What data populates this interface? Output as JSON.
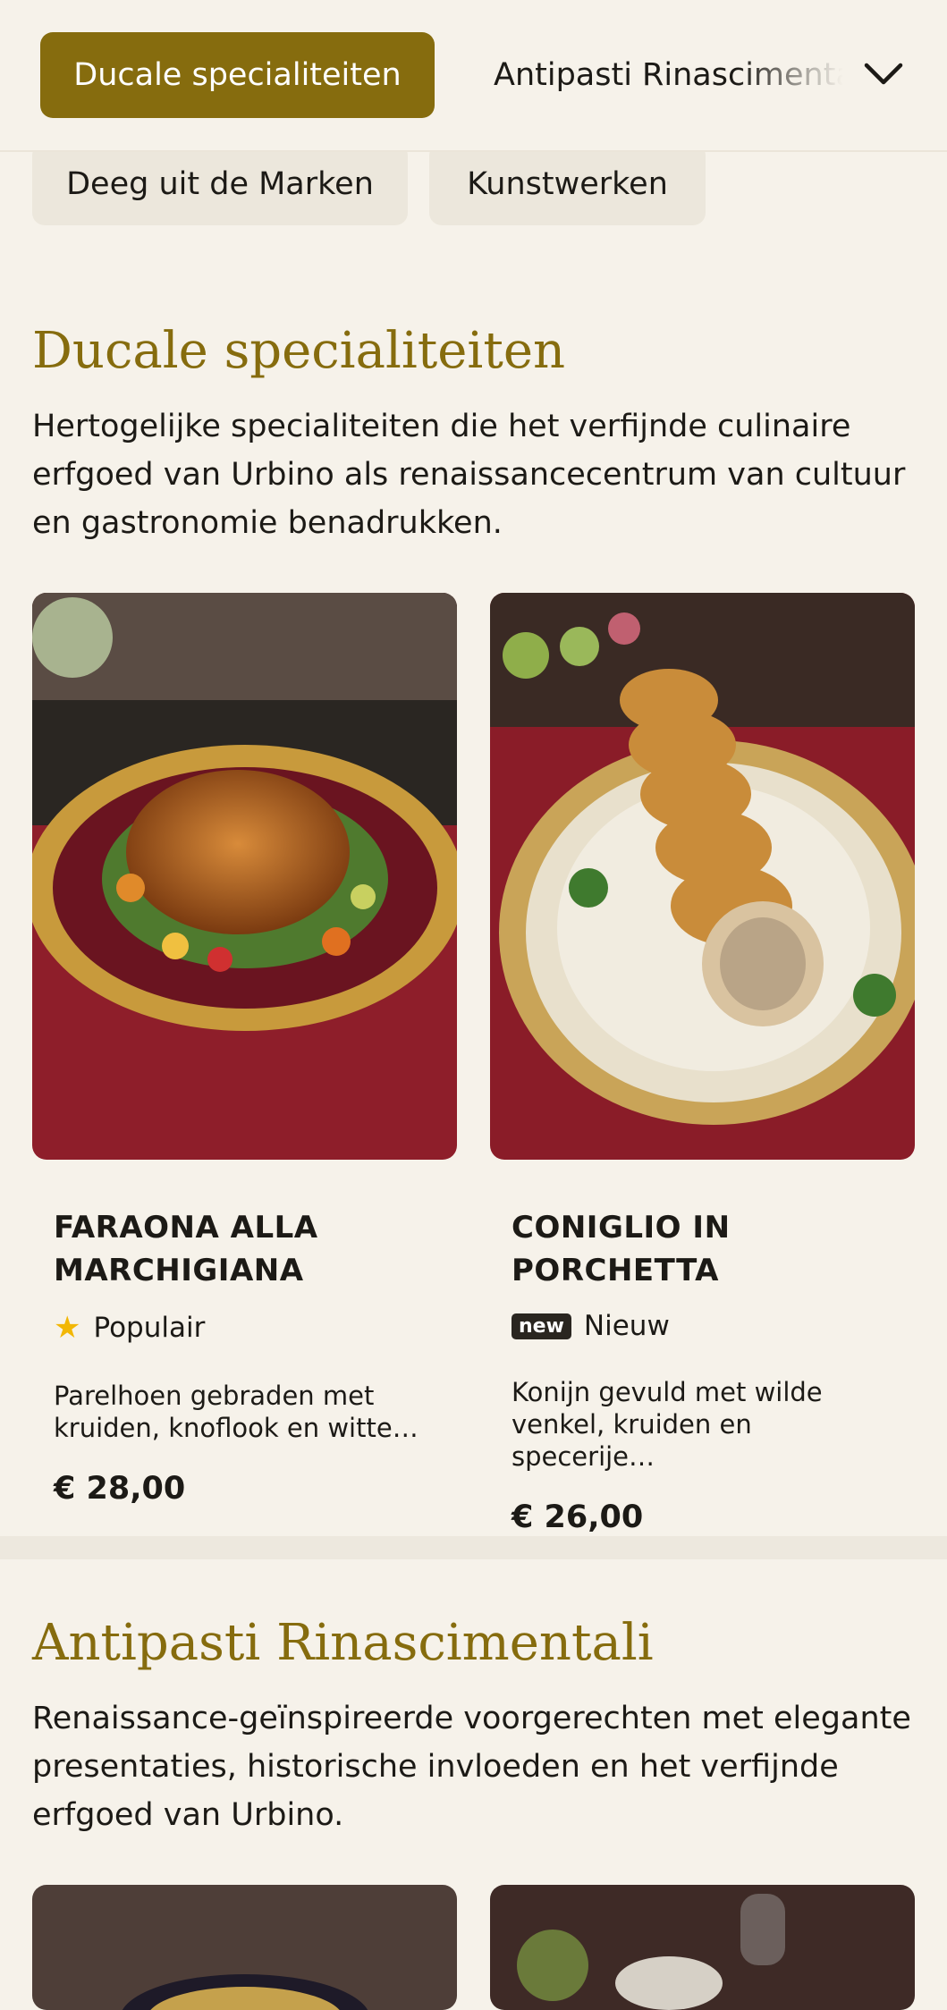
{
  "nav": {
    "active_category": "Ducale specialiteiten",
    "next_category": "Antipasti Rinascimentali",
    "row2": [
      "Deeg uit de Marken",
      "Kunstwerken"
    ]
  },
  "sections": [
    {
      "title": "Ducale specialiteiten",
      "description": "Hertogelijke specialiteiten die het verfijnde culinaire erfgoed van Urbino als renaissancecentrum van cultuur en gastronomie benadrukken.",
      "items": [
        {
          "name": "FARAONA ALLA MARCHIGIANA",
          "badge": "Populair",
          "badge_icon": "star-icon",
          "description": "Parelhoen gebraden met kruiden, knoflook en witte…",
          "price": "€ 28,00"
        },
        {
          "name": "CONIGLIO IN PORCHETTA",
          "badge_tag": "new",
          "badge": "Nieuw",
          "description": "Konijn gevuld met wilde venkel, kruiden en specerije…",
          "price": "€ 26,00"
        }
      ]
    },
    {
      "title": "Antipasti Rinascimentali",
      "description": "Renaissance-geïnspireerde voorgerechten met elegante presentaties, historische invloeden en het verfijnde erfgoed van Urbino."
    }
  ],
  "colors": {
    "accent": "#866c0e",
    "background": "#f6f2ea",
    "chip": "#ece7dc",
    "star": "#f2b705"
  }
}
